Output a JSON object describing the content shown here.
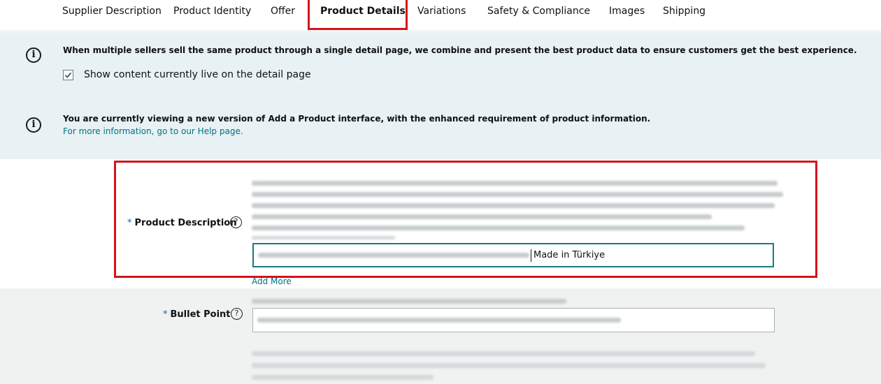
{
  "tabs": [
    {
      "label": "Supplier Description",
      "active": false
    },
    {
      "label": "Product Identity",
      "active": false
    },
    {
      "label": "Offer",
      "active": false
    },
    {
      "label": "Product Details",
      "active": true
    },
    {
      "label": "Variations",
      "active": false
    },
    {
      "label": "Safety & Compliance",
      "active": false
    },
    {
      "label": "Images",
      "active": false
    },
    {
      "label": "Shipping",
      "active": false
    }
  ],
  "banner": {
    "combine_message": "When multiple sellers sell the same product through a single detail page, we combine and present the best product data to ensure customers get the best experience.",
    "show_live_label": "Show content currently live on the detail page",
    "show_live_checked": true,
    "version_message": "You are currently viewing a new version of Add a Product interface, with the enhanced requirement of product information.",
    "help_link": "For more information, go to our Help page."
  },
  "fields": {
    "product_description": {
      "label": "Product Description",
      "required_marker": "*",
      "input_value": "Made in Türkiye",
      "add_more": "Add More"
    },
    "bullet_point": {
      "label": "Bullet Point",
      "required_marker": "*"
    }
  },
  "colors": {
    "highlight": "#d4141a",
    "link": "#007185",
    "banner_bg": "#e8f1f3",
    "focus_border": "#1a7a84"
  },
  "icons": {
    "info": "info-circle-icon",
    "help": "question-circle-icon",
    "check": "checkmark-icon"
  }
}
